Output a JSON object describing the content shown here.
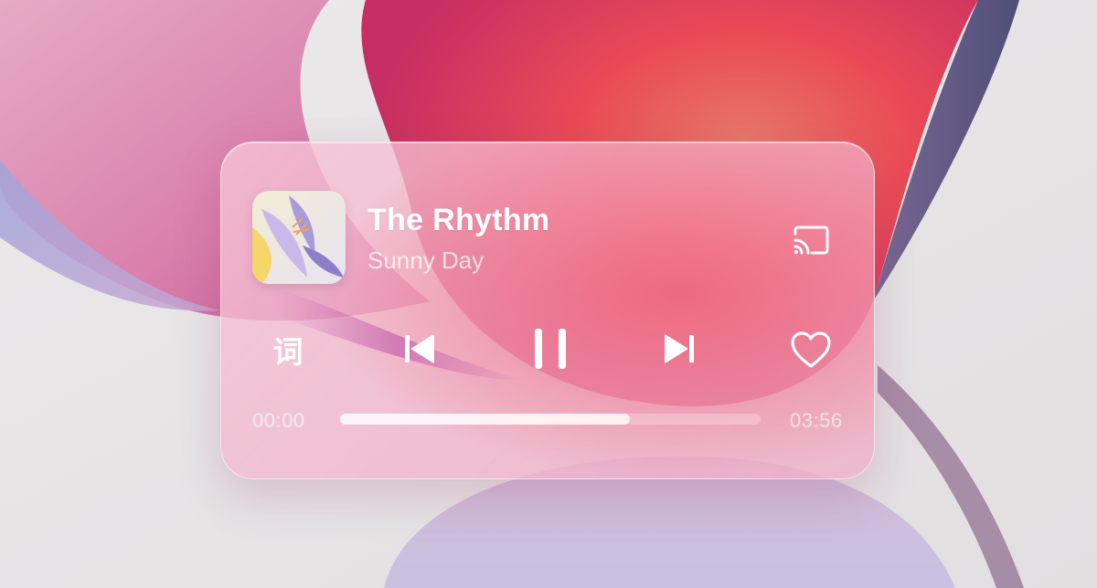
{
  "player": {
    "track_title": "The Rhythm",
    "artist": "Sunny Day",
    "lyrics_label": "词",
    "current_time": "00:00",
    "total_time": "03:56",
    "progress_fraction": 0.69,
    "controls": {
      "cast": "cast-icon",
      "lyrics": "lyrics-icon",
      "previous": "skip-previous-icon",
      "pause": "pause-icon",
      "next": "skip-next-icon",
      "favorite": "heart-icon"
    }
  },
  "colors": {
    "card_tint": "#f2b6cc",
    "icon": "#ffffff",
    "background_accent": "#ef4a5a"
  }
}
